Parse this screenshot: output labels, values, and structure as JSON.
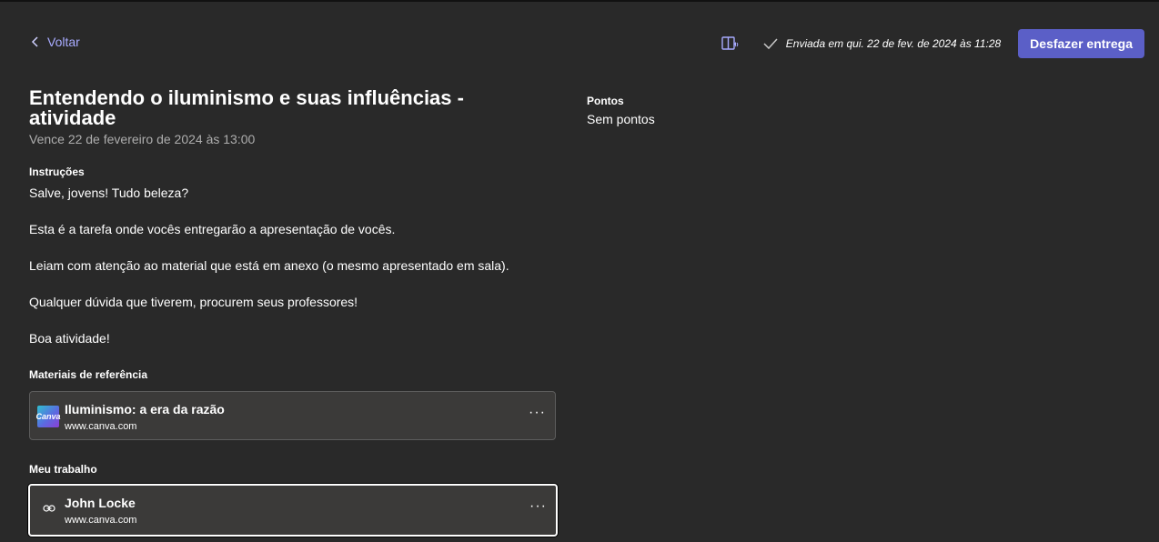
{
  "header": {
    "back_label": "Voltar",
    "sent_status": "Enviada em qui. 22 de fev. de 2024 às 11:28",
    "undo_label": "Desfazer entrega"
  },
  "assignment": {
    "title": "Entendendo o iluminismo e suas influências - atividade",
    "due": "Vence 22 de fevereiro de 2024 às 13:00",
    "instructions_label": "Instruções",
    "instructions": [
      "Salve, jovens! Tudo beleza?",
      "Esta é a tarefa onde vocês entregarão a apresentação de vocês.",
      "Leiam com atenção ao material que está em anexo (o mesmo apresentado em sala).",
      "Qualquer dúvida que tiverem, procurem seus professores!",
      "Boa atividade!"
    ],
    "materials_label": "Materiais de referência",
    "materials": [
      {
        "title": "Iluminismo: a era da razão",
        "url": "www.canva.com",
        "thumb_text": "Canva"
      }
    ],
    "my_work_label": "Meu trabalho",
    "my_work": [
      {
        "title": "John Locke",
        "url": "www.canva.com"
      }
    ]
  },
  "points": {
    "label": "Pontos",
    "value": "Sem pontos"
  },
  "more_glyph": "···",
  "colors": {
    "background": "#292929",
    "accent": "#5b5fc7",
    "link": "#a8abff",
    "card": "#3b3a39"
  }
}
